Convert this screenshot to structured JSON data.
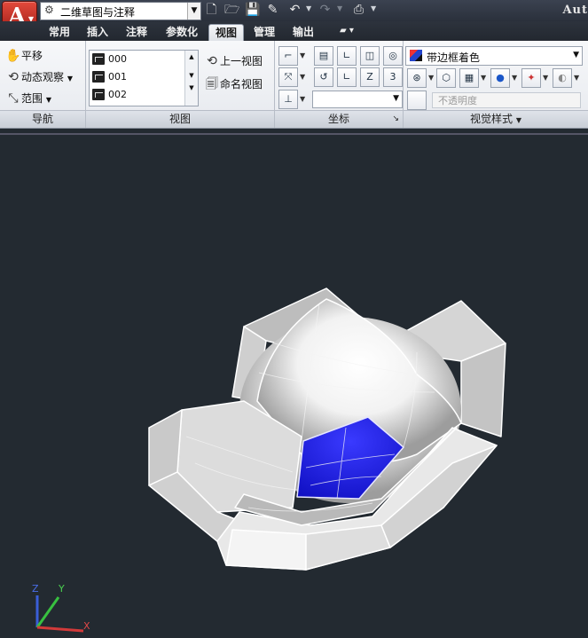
{
  "titlebar": {
    "workspace": "二维草图与注释",
    "app_title": "Aut",
    "quick_access": [
      "new-icon",
      "open-icon",
      "save-icon",
      "saveas-icon",
      "undo-icon",
      "redo-icon",
      "plot-icon"
    ]
  },
  "tabs": [
    {
      "label": "常用",
      "active": false
    },
    {
      "label": "插入",
      "active": false
    },
    {
      "label": "注释",
      "active": false
    },
    {
      "label": "参数化",
      "active": false
    },
    {
      "label": "视图",
      "active": true
    },
    {
      "label": "管理",
      "active": false
    },
    {
      "label": "输出",
      "active": false
    }
  ],
  "panels": {
    "navigate": {
      "title": "导航",
      "pan": "平移",
      "orbit": "动态观察",
      "extents": "范围"
    },
    "views": {
      "title": "视图",
      "list": [
        "000",
        "001",
        "002"
      ],
      "prev_view": "上一视图",
      "named_view": "命名视图"
    },
    "coordinates": {
      "title": "坐标"
    },
    "visual_styles": {
      "title": "视觉样式",
      "current_style": "带边框着色",
      "opacity_placeholder": "不透明度"
    }
  },
  "ucs": {
    "x_label": "X",
    "y_label": "Y",
    "z_label": "Z"
  },
  "colors": {
    "viewport_bg": "#232a31",
    "highlight_face": "#1f1fd6",
    "model_light": "#ffffff",
    "model_shade": "#9a9a9a"
  }
}
